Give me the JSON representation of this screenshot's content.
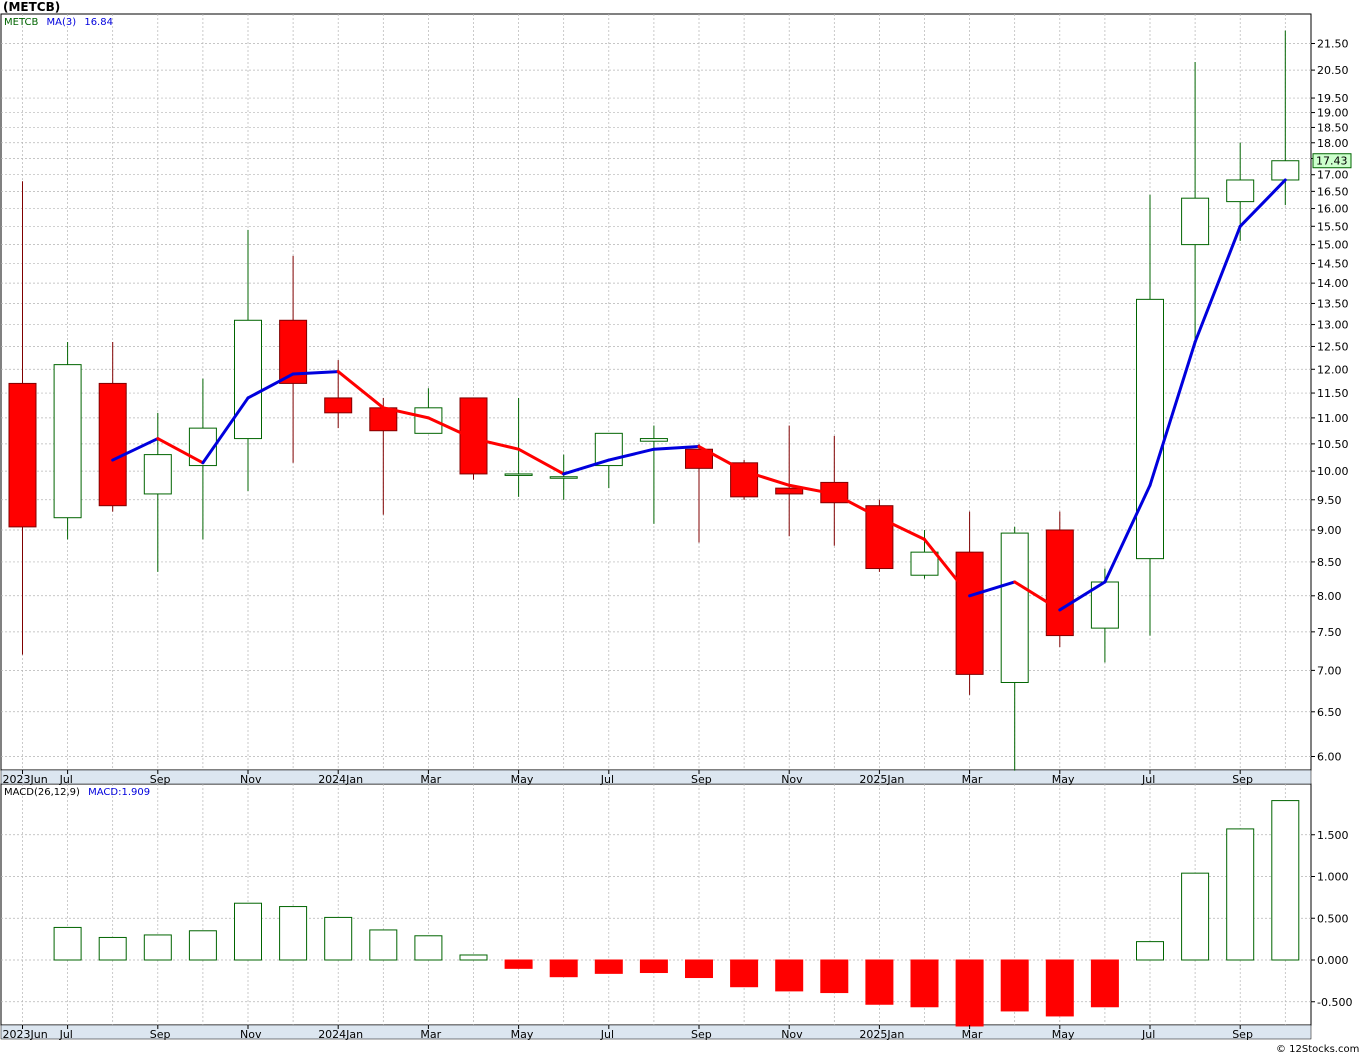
{
  "title": "(METCB)",
  "credit": "© 12Stocks.com",
  "price_panel": {
    "legend_symbol": "METCB",
    "legend_ma_name": "MA(3)",
    "legend_ma_value": "16.84",
    "last_price_label": "17.43",
    "y_ticks": [
      "21.50",
      "20.50",
      "19.50",
      "19.00",
      "18.50",
      "18.00",
      "17.50",
      "17.00",
      "16.50",
      "16.00",
      "15.50",
      "15.00",
      "14.50",
      "14.00",
      "13.50",
      "13.00",
      "12.50",
      "12.00",
      "11.50",
      "11.00",
      "10.50",
      "10.00",
      "9.50",
      "9.00",
      "8.50",
      "8.00",
      "7.50",
      "7.00",
      "6.50",
      "6.00"
    ],
    "date_labels": [
      "2023Jun",
      "Jul",
      "Sep",
      "Nov",
      "2024Jan",
      "Mar",
      "May",
      "Jul",
      "Sep",
      "Nov",
      "2025Jan",
      "Mar",
      "May",
      "Jul",
      "Sep"
    ]
  },
  "macd_panel": {
    "legend_name": "MACD(26,12,9)",
    "legend_value": "MACD:1.909",
    "y_ticks": [
      "1.500",
      "1.000",
      "0.500",
      "0.000",
      "-0.500"
    ],
    "date_labels": [
      "2023Jun",
      "Jul",
      "Sep",
      "Nov",
      "2024Jan",
      "Mar",
      "May",
      "Jul",
      "Sep",
      "Nov",
      "2025Jan",
      "Mar",
      "May",
      "Jul",
      "Sep"
    ]
  },
  "colors": {
    "up_border": "#006400",
    "down_fill": "#ff0000",
    "down_wick": "#800000",
    "ma_up": "#0000dd",
    "ma_down": "#ff0000",
    "grid": "#b4b4b4",
    "axis_band": "#dce6f0"
  },
  "chart_data": [
    {
      "type": "candlestick",
      "title": "(METCB)",
      "scale": "log",
      "ylim": [
        5.8,
        22.3
      ],
      "grid": true,
      "categories": [
        "2023-06",
        "2023-07",
        "2023-08",
        "2023-09",
        "2023-10",
        "2023-11",
        "2023-12",
        "2024-01",
        "2024-02",
        "2024-03",
        "2024-04",
        "2024-05",
        "2024-06",
        "2024-07",
        "2024-08",
        "2024-09",
        "2024-10",
        "2024-11",
        "2024-12",
        "2025-01",
        "2025-02",
        "2025-03",
        "2025-04",
        "2025-05",
        "2025-06",
        "2025-07",
        "2025-08",
        "2025-09",
        "2025-10"
      ],
      "series": [
        {
          "name": "METCB",
          "open": [
            11.7,
            9.2,
            11.7,
            9.6,
            10.1,
            10.6,
            13.1,
            11.4,
            11.2,
            10.7,
            11.4,
            9.95,
            9.9,
            10.1,
            10.55,
            10.4,
            10.15,
            9.7,
            9.8,
            9.4,
            8.3,
            8.65,
            6.85,
            9.0,
            7.55,
            8.55,
            15.0,
            16.2,
            16.84
          ],
          "high": [
            16.8,
            12.6,
            12.6,
            11.1,
            11.8,
            15.4,
            14.7,
            12.2,
            11.4,
            11.6,
            11.4,
            11.4,
            10.3,
            10.7,
            10.85,
            10.5,
            10.2,
            10.85,
            10.65,
            9.5,
            9.0,
            9.3,
            9.05,
            9.3,
            8.4,
            16.4,
            20.8,
            18.0,
            22.0
          ],
          "low": [
            7.2,
            8.85,
            9.3,
            8.35,
            8.85,
            9.65,
            10.15,
            10.8,
            9.25,
            10.7,
            9.85,
            9.55,
            9.5,
            9.7,
            9.1,
            8.8,
            9.5,
            8.9,
            8.75,
            8.35,
            8.25,
            6.7,
            5.85,
            7.3,
            7.1,
            7.45,
            12.5,
            15.1,
            16.1
          ],
          "close": [
            9.05,
            12.1,
            9.4,
            10.3,
            10.8,
            13.1,
            11.7,
            11.1,
            10.75,
            11.2,
            9.95,
            9.95,
            9.9,
            10.7,
            10.6,
            10.05,
            9.55,
            9.6,
            9.45,
            8.4,
            8.65,
            6.95,
            8.95,
            7.45,
            8.2,
            13.6,
            16.3,
            16.84,
            17.43
          ]
        },
        {
          "name": "MA(3)",
          "values": [
            null,
            null,
            10.2,
            10.6,
            10.15,
            11.4,
            11.9,
            11.95,
            11.2,
            11.0,
            10.6,
            10.4,
            9.95,
            10.2,
            10.4,
            10.45,
            10.0,
            9.75,
            9.6,
            9.2,
            8.85,
            8.0,
            8.2,
            7.8,
            8.2,
            9.75,
            12.6,
            15.5,
            16.84
          ]
        }
      ]
    },
    {
      "type": "bar",
      "title": "MACD(26,12,9)",
      "ylim": [
        -0.8,
        1.95
      ],
      "grid": true,
      "categories": [
        "2023-06",
        "2023-07",
        "2023-08",
        "2023-09",
        "2023-10",
        "2023-11",
        "2023-12",
        "2024-01",
        "2024-02",
        "2024-03",
        "2024-04",
        "2024-05",
        "2024-06",
        "2024-07",
        "2024-08",
        "2024-09",
        "2024-10",
        "2024-11",
        "2024-12",
        "2025-01",
        "2025-02",
        "2025-03",
        "2025-04",
        "2025-05",
        "2025-06",
        "2025-07",
        "2025-08",
        "2025-09",
        "2025-10"
      ],
      "series": [
        {
          "name": "MACD",
          "values": [
            null,
            0.39,
            0.27,
            0.3,
            0.35,
            0.68,
            0.64,
            0.51,
            0.36,
            0.29,
            0.06,
            -0.1,
            -0.2,
            -0.16,
            -0.15,
            -0.21,
            -0.32,
            -0.37,
            -0.39,
            -0.53,
            -0.56,
            -0.79,
            -0.61,
            -0.67,
            -0.56,
            0.22,
            1.04,
            1.57,
            1.909
          ]
        }
      ]
    }
  ]
}
